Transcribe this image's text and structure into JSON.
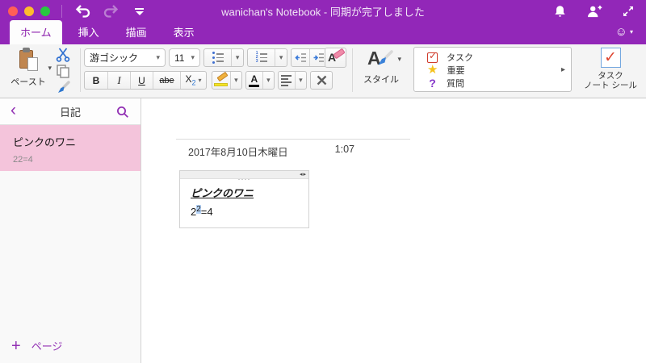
{
  "titlebar": {
    "title": "wanichan's Notebook - 同期が完了しました"
  },
  "tabs": [
    {
      "label": "ホーム",
      "active": true
    },
    {
      "label": "挿入",
      "active": false
    },
    {
      "label": "描画",
      "active": false
    },
    {
      "label": "表示",
      "active": false
    }
  ],
  "ribbon": {
    "paste_label": "ペースト",
    "font_name": "游ゴシック",
    "font_size": "11",
    "format": {
      "bold": "B",
      "italic": "I",
      "underline": "U",
      "strikethrough": "abe",
      "subscript_base": "X",
      "subscript_sub": "2",
      "erase_letter": "A",
      "font_color_letter": "A",
      "styles_letter": "A"
    },
    "styles_label": "スタイル",
    "tags": [
      {
        "label": "タスク"
      },
      {
        "label": "重要"
      },
      {
        "label": "質問"
      }
    ],
    "task_seal": {
      "line1": "タスク",
      "line2": "ノート シール"
    }
  },
  "sidebar": {
    "section_title": "日記",
    "pages": [
      {
        "title": "ピンクのワニ",
        "subtitle": "22=4",
        "selected": true
      }
    ],
    "new_page_label": "ページ"
  },
  "page": {
    "date": "2017年8月10日木曜日",
    "time": "1:07",
    "note_title": "ピンクのワニ",
    "equation": {
      "base": "2",
      "superscript": "2",
      "rest": "=4"
    }
  },
  "icons": {
    "dropdown": "▾",
    "back_chevron": "‹",
    "gallery_more": "▸",
    "check": "✓",
    "star": "★",
    "question": "?",
    "smiley": "☺",
    "plus": "+",
    "drag_dots": "····",
    "resize_handles": "◂▸",
    "numbered_digits": "1\n2\n3"
  },
  "colors": {
    "header_purple": "#9227b8",
    "accent_purple": "#9231b4",
    "selected_page_pink": "#f4c4db",
    "selection_blue": "#b6d4f8",
    "tag_check_red": "#cf3a2a",
    "star_gold": "#f5c21d",
    "question_purple": "#8435c9",
    "traffic_red": "#ff5f57",
    "traffic_yellow": "#febc2e",
    "traffic_green": "#28c840"
  }
}
